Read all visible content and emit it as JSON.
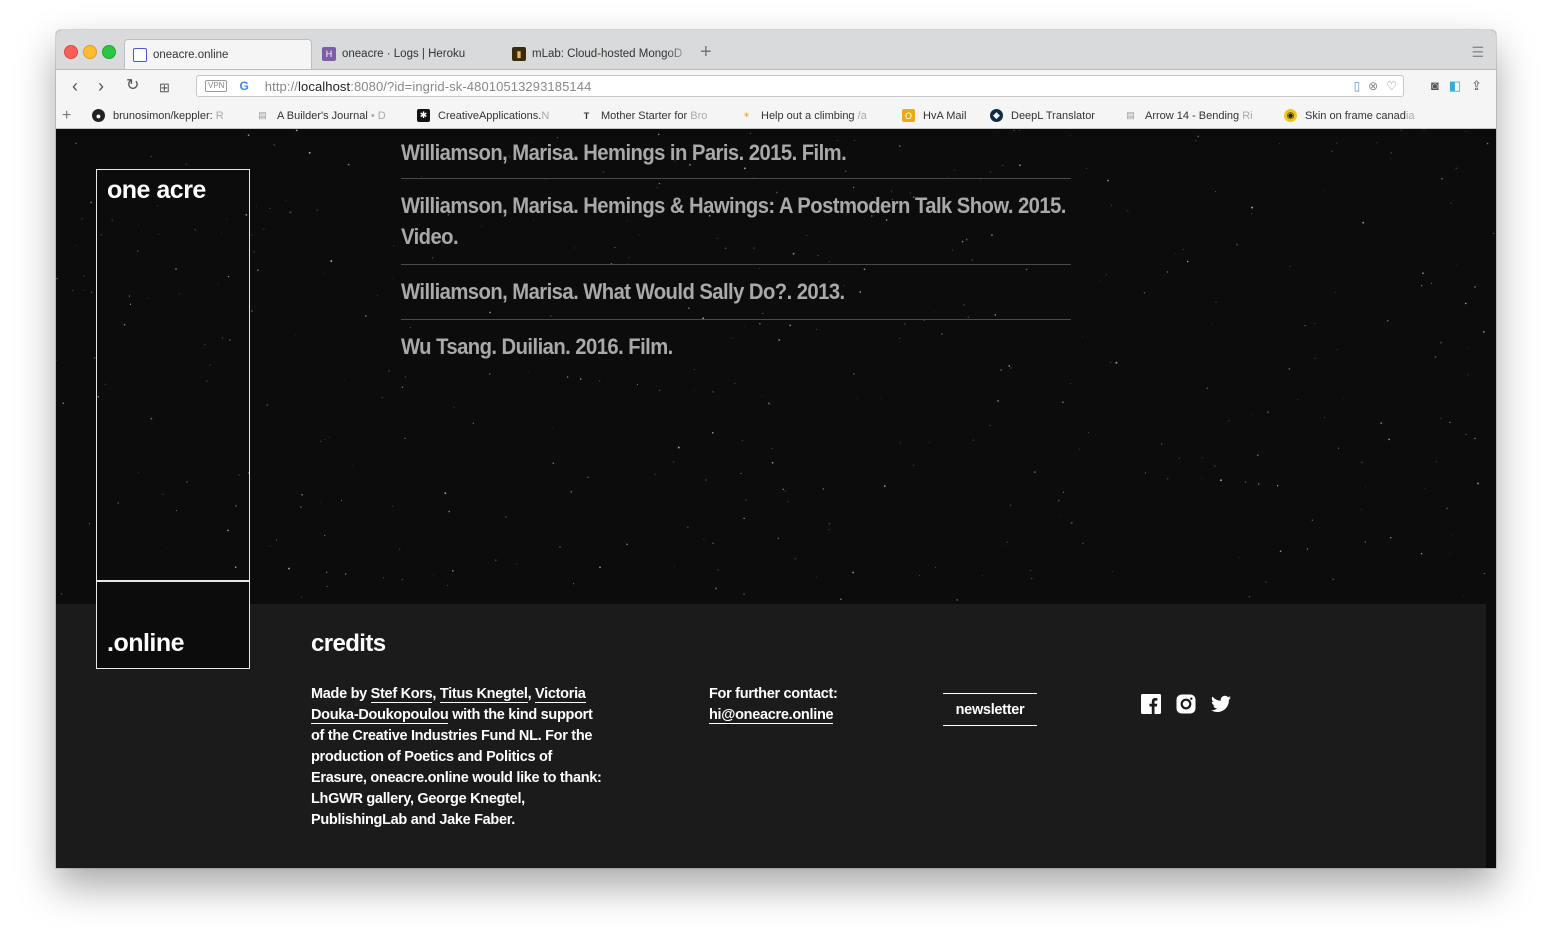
{
  "browser": {
    "tabs": [
      {
        "title": "oneacre.online",
        "active": true
      },
      {
        "title": "oneacre · Logs | Heroku",
        "active": false
      },
      {
        "title": "mLab: Cloud-hosted MongoD",
        "active": false
      }
    ],
    "url_prefix": "http://",
    "url_host": "localhost",
    "url_rest": ":8080/?id=ingrid-sk-48010513293185144",
    "vpn_label": "VPN",
    "bookmarks": [
      {
        "label": "brunosimon/keppler:",
        "fade": "R"
      },
      {
        "label": "A Builder's Journal",
        "fade": "• D"
      },
      {
        "label": "CreativeApplications.",
        "fade": "N"
      },
      {
        "label": "Mother Starter for",
        "fade": "Bro"
      },
      {
        "label": "Help out a climbing",
        "fade": "/a"
      },
      {
        "label": "HvA Mail",
        "fade": ""
      },
      {
        "label": "DeepL Translator",
        "fade": ""
      },
      {
        "label": "Arrow 14 - Bending",
        "fade": "Ri"
      },
      {
        "label": "Skin on frame canad",
        "fade": "ia"
      }
    ]
  },
  "entries": [
    "Williamson, Marisa. Hemings in Paris. 2015. Film.",
    "Williamson, Marisa. Hemings & Hawings: A Postmodern Talk Show. 2015. Video.",
    "Williamson, Marisa. What Would Sally Do?. 2013.",
    "Wu Tsang. Duilian. 2016. Film."
  ],
  "logo": {
    "top": "one acre",
    "bottom": ".online"
  },
  "footer": {
    "credits_title": "credits",
    "made_by": "Made by",
    "person1": "Stef Kors",
    "person2": "Titus Knegtel",
    "person3": "Victoria Douka-Doukopoulou",
    "credits_rest": "with the kind support of the Creative Industries Fund NL. For the production of Poetics and Politics of Erasure, oneacre.online would like to thank: LhGWR gallery, George Knegtel, PublishingLab and Jake Faber.",
    "contact_label": "For further contact:",
    "contact_email": "hi@oneacre.online",
    "newsletter": "newsletter"
  },
  "social_icons": [
    "facebook-icon",
    "instagram-icon",
    "twitter-icon"
  ]
}
